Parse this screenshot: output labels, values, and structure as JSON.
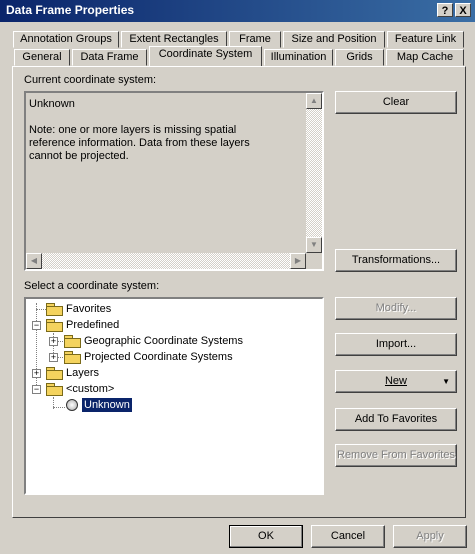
{
  "window": {
    "title": "Data Frame Properties",
    "help_label": "?",
    "close_label": "X"
  },
  "tabs_row1": [
    "Annotation Groups",
    "Extent Rectangles",
    "Frame",
    "Size and Position",
    "Feature Link"
  ],
  "tabs_row2": [
    "General",
    "Data Frame",
    "Coordinate System",
    "Illumination",
    "Grids",
    "Map Cache"
  ],
  "active_tab": "Coordinate System",
  "current": {
    "label": "Current coordinate system:",
    "name": "Unknown",
    "note_lines": [
      "Note: one or more layers is missing spatial",
      "reference information.  Data from these layers",
      "cannot be projected."
    ]
  },
  "select_label": "Select a coordinate system:",
  "tree": {
    "favorites": "Favorites",
    "predefined": "Predefined",
    "geographic": "Geographic Coordinate Systems",
    "projected": "Projected Coordinate Systems",
    "layers": "Layers",
    "custom": "<custom>",
    "unknown": "Unknown"
  },
  "buttons": {
    "clear": "Clear",
    "transformations": "Transformations...",
    "modify": "Modify...",
    "import": "Import...",
    "new": "New",
    "add_favorites": "Add To Favorites",
    "remove_favorites": "Remove From Favorites"
  },
  "footer": {
    "ok": "OK",
    "cancel": "Cancel",
    "apply": "Apply"
  }
}
